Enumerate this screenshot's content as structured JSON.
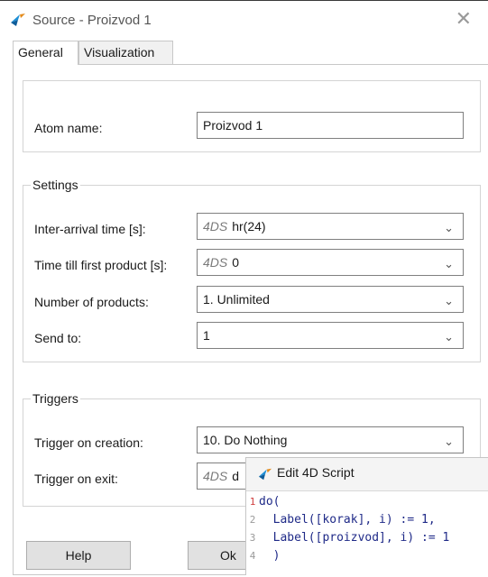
{
  "window": {
    "title": "Source - Proizvod 1",
    "close_glyph": "✕"
  },
  "tabs": [
    {
      "label": "General"
    },
    {
      "label": "Visualization"
    }
  ],
  "atom": {
    "label": "Atom name:",
    "value": "Proizvod 1"
  },
  "settings": {
    "title": "Settings",
    "inter_arrival": {
      "label": "Inter-arrival time [s]:",
      "prefix": "4DS",
      "value": "hr(24)"
    },
    "first_product": {
      "label": "Time till first product [s]:",
      "prefix": "4DS",
      "value": "0"
    },
    "num_products": {
      "label": "Number of products:",
      "value": "1. Unlimited"
    },
    "send_to": {
      "label": "Send to:",
      "value": "1"
    }
  },
  "triggers": {
    "title": "Triggers",
    "on_creation": {
      "label": "Trigger on creation:",
      "value": "10. Do Nothing"
    },
    "on_exit": {
      "label": "Trigger on exit:",
      "prefix": "4DS",
      "value": "d"
    }
  },
  "buttons": {
    "help": "Help",
    "ok": "Ok"
  },
  "script_editor": {
    "title": "Edit 4D Script",
    "lines": [
      {
        "num": "1",
        "text": "do("
      },
      {
        "num": "2",
        "text": "  Label([korak], i) := 1,"
      },
      {
        "num": "3",
        "text": "  Label([proizvod], i) := 1"
      },
      {
        "num": "4",
        "text": "  )"
      }
    ]
  },
  "colors": {
    "accent": "#1e8fd6",
    "keyword": "#1f2a88",
    "number": "#2c8a2c",
    "prefix": "#7a7a7a"
  },
  "icons": {
    "app": "source-atom-icon",
    "dropdown": "chevron-down-icon",
    "close": "close-icon"
  }
}
